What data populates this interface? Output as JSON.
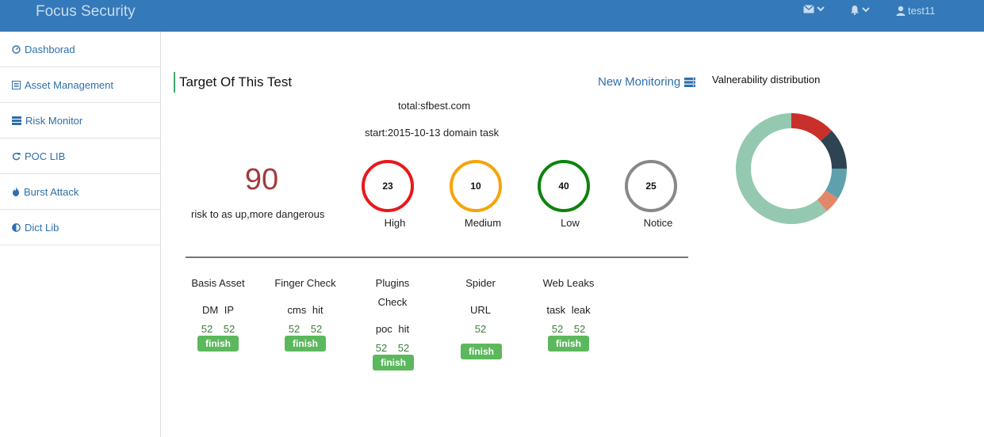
{
  "header": {
    "brand": "Focus Security",
    "user": "test11"
  },
  "sidebar": {
    "items": [
      {
        "label": "Dashborad",
        "icon": "dashboard-icon"
      },
      {
        "label": "Asset Management",
        "icon": "list-icon"
      },
      {
        "label": "Risk Monitor",
        "icon": "server-icon"
      },
      {
        "label": "POC LIB",
        "icon": "refresh-icon"
      },
      {
        "label": "Burst Attack",
        "icon": "fire-icon"
      },
      {
        "label": "Dict Lib",
        "icon": "contrast-icon"
      }
    ]
  },
  "target": {
    "title": "Target Of This Test",
    "new_monitoring": "New Monitoring",
    "total": "total:sfbest.com",
    "start": "start:2015-10-13 domain task",
    "score": "90",
    "score_label": "risk to as up,more dangerous"
  },
  "levels": [
    {
      "count": "23",
      "label": "High",
      "color": "#e8181c"
    },
    {
      "count": "10",
      "label": "Medium",
      "color": "#f5a40d"
    },
    {
      "count": "40",
      "label": "Low",
      "color": "#0e820e"
    },
    {
      "count": "25",
      "label": "Notice",
      "color": "#888888"
    }
  ],
  "tasks": {
    "basis": {
      "title": "Basis Asset",
      "sub": "DM IP",
      "values": "52 52",
      "status": "finish"
    },
    "finger": {
      "title": "Finger Check",
      "sub": "cms hit",
      "values": "52 52",
      "status": "finish"
    },
    "plugins": {
      "title_line1": "Plugins",
      "title_line2": "Check",
      "sub": "poc hit",
      "values": "52 52",
      "status": "finish"
    },
    "spider": {
      "title": "Spider",
      "sub": "URL",
      "values": "52",
      "status": "finish"
    },
    "webleaks": {
      "title": "Web Leaks",
      "sub": "task leak",
      "values": "52 52",
      "status": "finish"
    }
  },
  "distribution": {
    "title": "Valnerability distribution",
    "segments": [
      {
        "value": 13,
        "color": "#c9302c"
      },
      {
        "value": 12,
        "color": "#2e4453"
      },
      {
        "value": 9,
        "color": "#5fa0ad"
      },
      {
        "value": 5,
        "color": "#e2876a"
      },
      {
        "value": 61,
        "color": "#94c9b0"
      }
    ]
  }
}
